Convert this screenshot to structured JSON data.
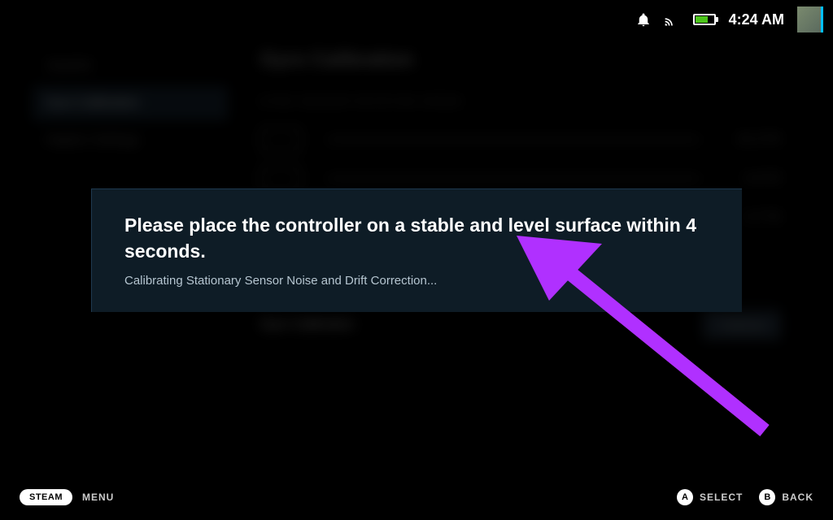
{
  "statusBar": {
    "time": "4:24 AM"
  },
  "background": {
    "sidebar": {
      "item1": "Joystick",
      "item2": "Gyro Calibration",
      "item3": "Haptics Settings"
    },
    "title": "Gyro Calibration",
    "subtitle": "GYRO SENSOR ROTATION SPEED",
    "val1": "-31.3°/S",
    "val2": "-4.4°/S",
    "val3": "4.7°/S",
    "calibrationLabel": "Gyro Calibration",
    "calibrateButton": "Calibrate"
  },
  "modal": {
    "title": "Please place the controller on a stable and level surface within 4 seconds.",
    "subtitle": "Calibrating Stationary Sensor Noise and Drift Correction..."
  },
  "bottomBar": {
    "steam": "STEAM",
    "menu": "MENU",
    "buttonA": "A",
    "selectLabel": "SELECT",
    "buttonB": "B",
    "backLabel": "BACK"
  }
}
